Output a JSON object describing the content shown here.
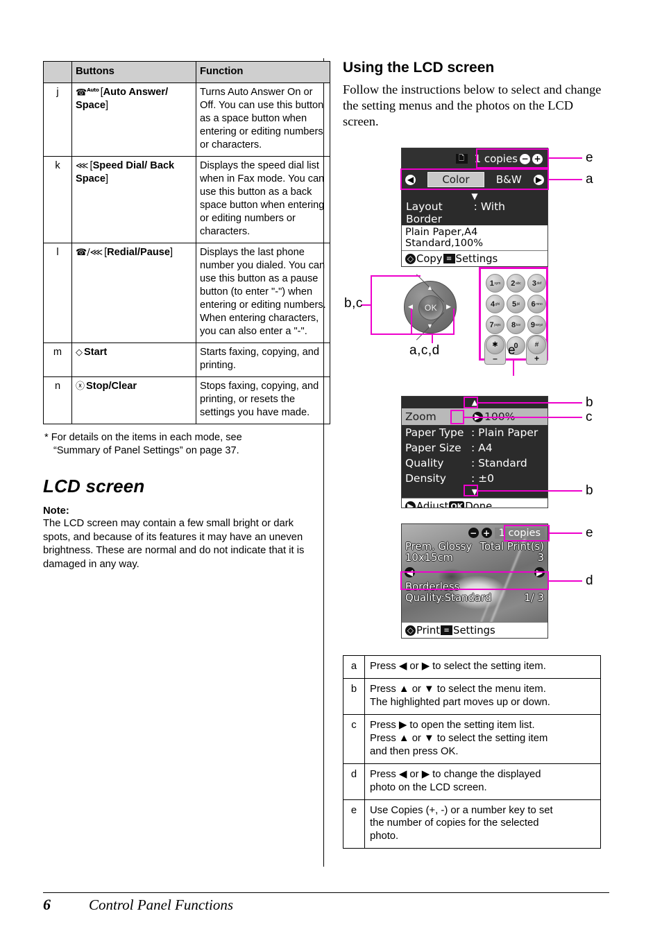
{
  "footer": {
    "page_number": "6",
    "title": "Control Panel Functions"
  },
  "left_column": {
    "buttons_table": {
      "headers": [
        "",
        "Buttons",
        "Function"
      ],
      "rows": [
        {
          "key": "j",
          "icon": "phone-auto-answer-icon",
          "button_prefix": "[",
          "button_bold": "Auto Answer/ Space",
          "button_suffix": "]",
          "function": "Turns Auto Answer On or Off. You can use this button as a space button when entering or editing numbers or characters."
        },
        {
          "key": "k",
          "icon": "speed-dial-icon",
          "button_prefix": "[",
          "button_bold": "Speed Dial/ Back Space",
          "button_suffix": "]",
          "function": "Displays the speed dial list when in Fax mode. You can use this button as a back space button when entering or editing numbers or characters."
        },
        {
          "key": "l",
          "icon": "redial-pause-icon",
          "button_prefix": "[",
          "button_bold": "Redial/Pause",
          "button_suffix": "]",
          "function": "Displays the last phone number you dialed. You can use this button as a pause button (to enter \"-\") when entering or editing numbers. When entering characters, you can also enter a \"-\"."
        },
        {
          "key": "m",
          "icon": "start-diamond-icon",
          "button_prefix": "",
          "button_bold": "Start",
          "button_suffix": "",
          "function": "Starts faxing, copying, and printing."
        },
        {
          "key": "n",
          "icon": "stop-clear-icon",
          "button_prefix": "",
          "button_bold": "Stop/Clear",
          "button_suffix": "",
          "function": "Stops faxing, copying, and printing, or resets the settings you have made."
        }
      ]
    },
    "footnote_line1": "* For details on the items in each mode, see",
    "footnote_line2": "“Summary of Panel Settings” on page 37.",
    "lcd_heading": "LCD screen",
    "note_title": "Note:",
    "note_body": "The LCD screen may contain a few small bright or dark spots, and because of its features it may have an uneven brightness. These are normal and do not indicate that it is damaged in any way."
  },
  "right_column": {
    "heading": "Using the LCD screen",
    "intro": "Follow the instructions below to select and change the setting menus and the photos on the LCD screen.",
    "screen_copy": {
      "copies_value": "1 copies",
      "minus_icon": "minus-circle-icon",
      "plus_icon": "plus-circle-icon",
      "page_icon": "copy-pages-icon",
      "left_arrow_icon": "left-arrow-icon",
      "right_arrow_icon": "right-arrow-icon",
      "mode_selected": "Color",
      "mode_other": "B&W",
      "down_caret_icon": "down-caret-icon",
      "layout_key": "Layout",
      "layout_colon": ":",
      "layout_value": "With Border",
      "info_line1": "Plain Paper,A4",
      "info_line2": "Standard,100%",
      "soft_start_icon": "start-diamond-icon",
      "soft_start_label": "Copy",
      "soft_menu_icon": "settings-menu-icon",
      "soft_menu_label": "Settings"
    },
    "screen_settings": {
      "up_arrow_icon": "up-triangle-icon",
      "down_arrow_icon": "down-triangle-icon",
      "selected_key": "Zoom",
      "selected_arrow_icon": "right-arrow-icon",
      "selected_value": "100%",
      "rows": [
        {
          "key": "Paper Type",
          "colon": ":",
          "value": "Plain Paper"
        },
        {
          "key": "Paper Size",
          "colon": ":",
          "value": "A4"
        },
        {
          "key": "Quality",
          "colon": ":",
          "value": "Standard"
        },
        {
          "key": "Density",
          "colon": ":",
          "value": "±0"
        }
      ],
      "soft_adjust_icon": "right-arrow-icon",
      "soft_adjust_label": "Adjust",
      "soft_ok_icon": "ok-key-icon",
      "soft_ok_label": "Done"
    },
    "screen_photo": {
      "minus_icon": "minus-circle-icon",
      "plus_icon": "plus-circle-icon",
      "copies_value": "1 copies",
      "line1_left": "Prem. Glossy",
      "line1_right": "Total Print(s)",
      "line2_left": "10x15cm",
      "line2_right": "3",
      "left_arrow_icon": "left-arrow-icon",
      "right_arrow_icon": "right-arrow-icon",
      "line3": "Borderless",
      "line4_left": "Quality:Standard",
      "line4_right": "1/  3",
      "soft_start_icon": "start-diamond-icon",
      "soft_start_label": "Print",
      "soft_menu_icon": "settings-menu-icon",
      "soft_menu_label": "Settings"
    },
    "navpad": {
      "ok_label": "OK",
      "up_icon": "up-triangle-icon",
      "down_icon": "down-triangle-icon",
      "left_icon": "left-triangle-icon",
      "right_icon": "right-triangle-icon"
    },
    "keypad": {
      "keys": [
        {
          "num": "1",
          "letters": "sym"
        },
        {
          "num": "2",
          "letters": "abc"
        },
        {
          "num": "3",
          "letters": "def"
        },
        {
          "num": "4",
          "letters": "ghi"
        },
        {
          "num": "5",
          "letters": "jkl"
        },
        {
          "num": "6",
          "letters": "mno"
        },
        {
          "num": "7",
          "letters": "pqrs"
        },
        {
          "num": "8",
          "letters": "tuv"
        },
        {
          "num": "9",
          "letters": "wxyz"
        }
      ],
      "star": "✱",
      "zero": "0",
      "hash": "#",
      "minus": "–",
      "plus": "+"
    },
    "callouts": {
      "copy_copies": "e",
      "copy_mode": "a",
      "navpad_left": "b,c",
      "navpad_bottom": "a,c,d",
      "keypad": "e",
      "settings_up": "b",
      "settings_zoom": "c",
      "settings_down": "b",
      "photo_copies": "e",
      "photo_arrows": "d"
    },
    "legend_table": {
      "rows": [
        {
          "key": "a",
          "lines": [
            "Press ◀ or ▶ to select the setting item."
          ]
        },
        {
          "key": "b",
          "lines": [
            "Press ▲ or ▼ to select the menu item.",
            "The highlighted part moves up or down."
          ]
        },
        {
          "key": "c",
          "lines": [
            "Press ▶ to open the setting item list.",
            "Press ▲ or ▼ to select the setting item",
            "and then press OK."
          ]
        },
        {
          "key": "d",
          "lines": [
            "Press ◀ or ▶ to change the displayed",
            "photo on the LCD screen."
          ]
        },
        {
          "key": "e",
          "lines": [
            "Use Copies (+, -) or a number key to set",
            "the number of copies for the selected",
            "photo."
          ]
        }
      ]
    }
  },
  "colors": {
    "highlight": "#ee00cc",
    "header_fill": "#cfcfcf",
    "lcd_dark": "#2b2b2b"
  }
}
